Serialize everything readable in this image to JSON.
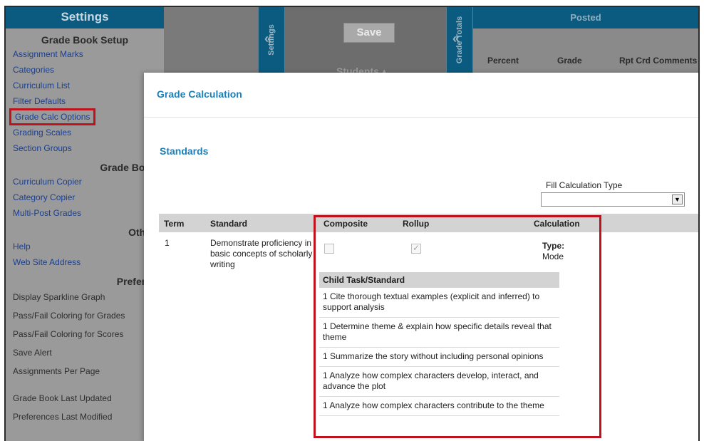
{
  "sidebar": {
    "header": "Settings",
    "grade_book_setup": {
      "title": "Grade Book Setup",
      "links": [
        "Assignment Marks",
        "Categories",
        "Curriculum List",
        "Filter Defaults",
        "Grade Calc Options",
        "Grading Scales",
        "Section Groups"
      ]
    },
    "grade_book_tools": {
      "title": "Grade Boo",
      "links": [
        "Curriculum Copier",
        "Category Copier",
        "Multi-Post Grades"
      ]
    },
    "other": {
      "title": "Othe",
      "links": [
        "Help",
        "Web Site Address"
      ]
    },
    "preferences": {
      "title": "Prefere",
      "items": [
        "Display Sparkline Graph",
        "Pass/Fail Coloring for Grades",
        "Pass/Fail Coloring for Scores",
        "Save Alert",
        "Assignments Per Page"
      ],
      "footer_items": [
        "Grade Book Last Updated",
        "Preferences Last Modified"
      ]
    }
  },
  "tabs": {
    "settings_tab": "Settings",
    "grade_totals_tab": "Grade Totals"
  },
  "toolbar": {
    "save_label": "Save",
    "students_label": "Students ▴"
  },
  "posted": {
    "title": "Posted",
    "columns": [
      "Percent",
      "Grade",
      "Rpt Crd Comments"
    ]
  },
  "modal": {
    "title": "Grade Calculation",
    "section_title": "Standards",
    "fill_calc_label": "Fill Calculation Type",
    "fill_calc_value": "",
    "headers": {
      "term": "Term",
      "standard": "Standard",
      "composite": "Composite",
      "rollup": "Rollup",
      "calculation": "Calculation"
    },
    "row": {
      "term": "1",
      "standard": "Demonstrate proficiency in basic concepts of scholarly writing",
      "composite_checked": false,
      "rollup_checked": true,
      "calc_type_label": "Type:",
      "calc_type_value": "Mode"
    },
    "child_header": "Child Task/Standard",
    "child_items": [
      "1 Cite thorough textual examples (explicit and inferred) to support analysis",
      "1 Determine theme & explain how specific details reveal that theme",
      "1 Summarize the story without including personal opinions",
      "1 Analyze how complex characters develop, interact, and advance the plot",
      "1 Analyze how complex characters contribute to the theme"
    ]
  },
  "colors": {
    "header_blue": "#0b5b80",
    "link_blue": "#1e7fb8",
    "highlight_red": "#c0121d"
  }
}
